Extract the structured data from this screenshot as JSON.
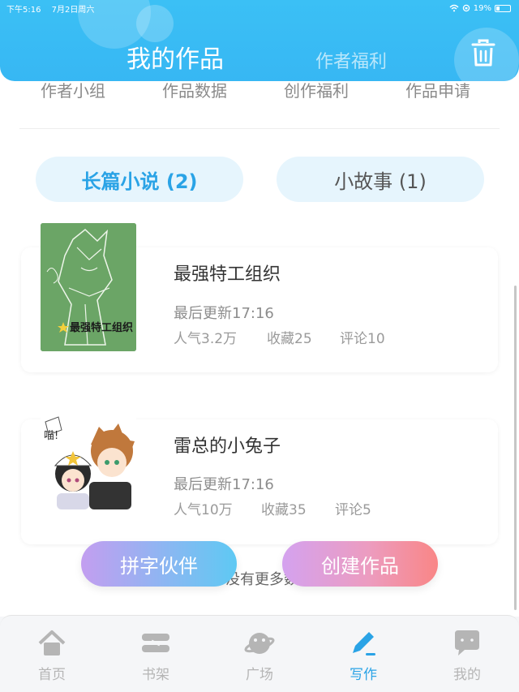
{
  "status_bar": {
    "time": "下午5:16",
    "date": "7月2日周六",
    "battery": "19%"
  },
  "header": {
    "title": "我的作品",
    "subtitle": "作者福利"
  },
  "subnav": [
    "作者小组",
    "作品数据",
    "创作福利",
    "作品申请"
  ],
  "tabs": [
    {
      "label": "长篇小说 (2)",
      "active": true
    },
    {
      "label": "小故事 (1)",
      "active": false
    }
  ],
  "works": [
    {
      "title": "最强特工组织",
      "cover_text": "最强特工组织",
      "update": "最后更新17:16",
      "popularity": "人气3.2万",
      "favorites": "收藏25",
      "comments": "评论10"
    },
    {
      "title": "雷总的小兔子",
      "cover_text": "喵!",
      "update": "最后更新17:16",
      "popularity": "人气10万",
      "favorites": "收藏35",
      "comments": "评论5"
    }
  ],
  "list_footer": "没有更多数据",
  "actions": {
    "partner": "拼字伙伴",
    "create": "创建作品"
  },
  "tabbar": [
    {
      "label": "首页",
      "icon": "home-icon",
      "active": false
    },
    {
      "label": "书架",
      "icon": "bookshelf-icon",
      "active": false
    },
    {
      "label": "广场",
      "icon": "planet-icon",
      "active": false
    },
    {
      "label": "写作",
      "icon": "pen-icon",
      "active": true
    },
    {
      "label": "我的",
      "icon": "chat-icon",
      "active": false
    }
  ],
  "colors": {
    "accent": "#2aa3e6",
    "header": "#3bc0f5",
    "inactive": "#b5b5b5"
  }
}
